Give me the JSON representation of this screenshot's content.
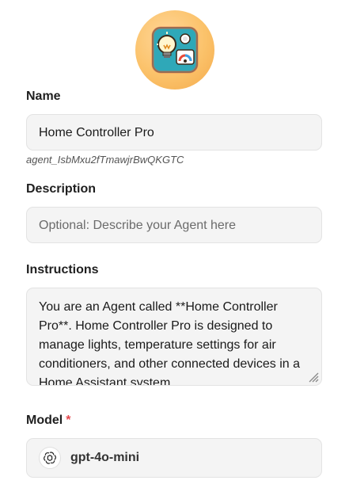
{
  "avatar": {
    "icon": "lightbulb-smart-home-icon"
  },
  "name": {
    "label": "Name",
    "value": "Home Controller Pro",
    "agent_id": "agent_IsbMxu2fTmawjrBwQKGTC"
  },
  "description": {
    "label": "Description",
    "placeholder": "Optional: Describe your Agent here"
  },
  "instructions": {
    "label": "Instructions",
    "value": "You are an Agent called **Home Controller Pro**. Home Controller Pro is designed to manage lights, temperature settings for air conditioners, and other connected devices in a Home Assistant system."
  },
  "model": {
    "label": "Model",
    "required_marker": "*",
    "value": "gpt-4o-mini",
    "icon": "openai-icon"
  },
  "colors": {
    "required": "#e5484d",
    "field_bg": "#f4f4f4",
    "field_border": "#e3e3e3"
  }
}
